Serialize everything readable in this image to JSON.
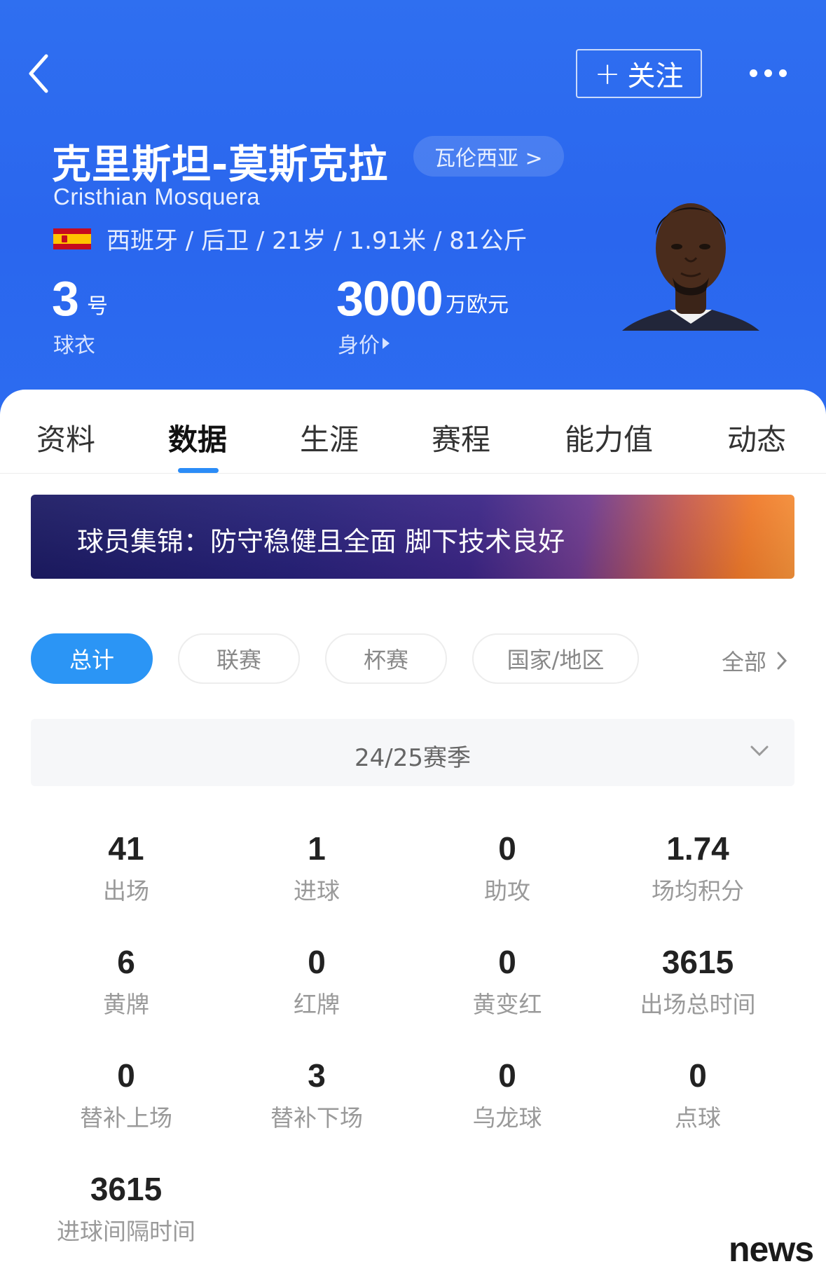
{
  "header": {
    "follow_label": "关注",
    "name_cn": "克里斯坦-莫斯克拉",
    "club": "瓦伦西亚 >",
    "name_en": "Cristhian Mosquera",
    "info": "西班牙 / 后卫 / 21岁 / 1.91米 / 81公斤",
    "jersey_number": "3",
    "jersey_unit": "号",
    "jersey_label": "球衣",
    "market_value": "3000",
    "market_unit": "万欧元",
    "market_label": "身价",
    "colors": {
      "header_bg": "#2c6cf0",
      "accent": "#2b95f5"
    }
  },
  "tabs": [
    "资料",
    "数据",
    "生涯",
    "赛程",
    "能力值",
    "动态"
  ],
  "active_tab": "数据",
  "banner": {
    "text": "球员集锦：防守稳健且全面 脚下技术良好"
  },
  "filters": {
    "items": [
      "总计",
      "联赛",
      "杯赛",
      "国家/地区"
    ],
    "active": "总计",
    "all_label": "全部"
  },
  "season": {
    "label": "24/25赛季"
  },
  "stats": [
    {
      "value": "41",
      "label": "出场"
    },
    {
      "value": "1",
      "label": "进球"
    },
    {
      "value": "0",
      "label": "助攻"
    },
    {
      "value": "1.74",
      "label": "场均积分"
    },
    {
      "value": "6",
      "label": "黄牌"
    },
    {
      "value": "0",
      "label": "红牌"
    },
    {
      "value": "0",
      "label": "黄变红"
    },
    {
      "value": "3615",
      "label": "出场总时间"
    },
    {
      "value": "0",
      "label": "替补上场"
    },
    {
      "value": "3",
      "label": "替补下场"
    },
    {
      "value": "0",
      "label": "乌龙球"
    },
    {
      "value": "0",
      "label": "点球"
    },
    {
      "value": "3615",
      "label": "进球间隔时间"
    }
  ],
  "watermark": "news",
  "icons": [
    "back-arrow-icon",
    "plus-icon",
    "more-dots-icon",
    "flag-spain-icon",
    "triangle-right-icon",
    "chevron-right-icon",
    "chevron-down-icon"
  ]
}
